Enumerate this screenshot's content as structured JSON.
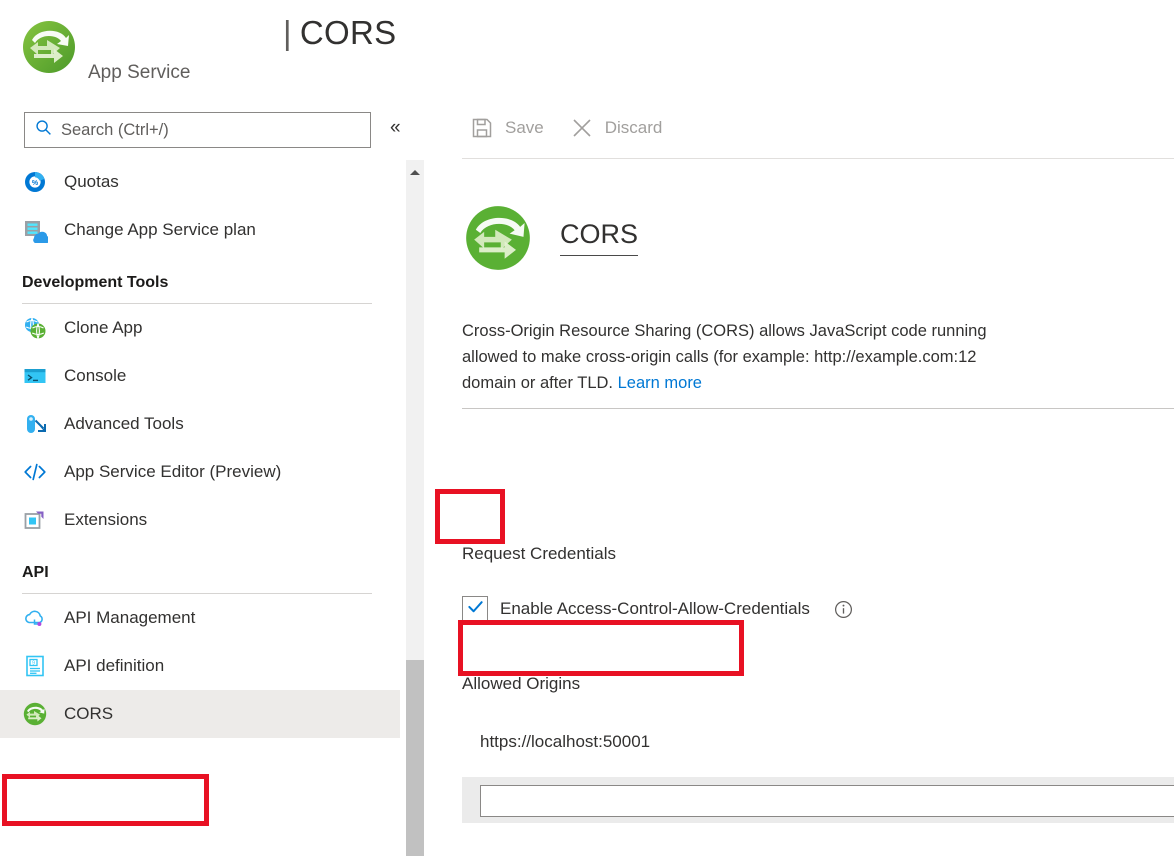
{
  "header": {
    "resource_name": "",
    "resource_type": "App Service",
    "blade_pipe": "|",
    "blade_title": "CORS",
    "logo_icon": "app-service-cors-icon"
  },
  "sidebar": {
    "search": {
      "placeholder": "Search (Ctrl+/)",
      "icon": "search-icon"
    },
    "collapse_icon": "chevron-double-left-icon",
    "items": [
      {
        "label": "Quotas",
        "icon": "quotas-percent-icon",
        "type": "item",
        "selected": false
      },
      {
        "label": "Change App Service plan",
        "icon": "app-service-plan-icon",
        "type": "item",
        "selected": false
      },
      {
        "label": "Development Tools",
        "type": "group"
      },
      {
        "label": "Clone App",
        "icon": "clone-app-icon",
        "type": "item",
        "selected": false
      },
      {
        "label": "Console",
        "icon": "console-terminal-icon",
        "type": "item",
        "selected": false
      },
      {
        "label": "Advanced Tools",
        "icon": "advanced-tools-icon",
        "type": "item",
        "selected": false
      },
      {
        "label": "App Service Editor (Preview)",
        "icon": "code-brackets-icon",
        "type": "item",
        "selected": false
      },
      {
        "label": "Extensions",
        "icon": "extensions-icon",
        "type": "item",
        "selected": false
      },
      {
        "label": "API",
        "type": "group"
      },
      {
        "label": "API Management",
        "icon": "api-management-cloud-icon",
        "type": "item",
        "selected": false
      },
      {
        "label": "API definition",
        "icon": "api-definition-document-icon",
        "type": "item",
        "selected": false
      },
      {
        "label": "CORS",
        "icon": "cors-icon",
        "type": "item",
        "selected": true
      }
    ],
    "scrollbar": {
      "up_arrow_icon": "scroll-up-arrow-icon"
    }
  },
  "toolbar": {
    "save_label": "Save",
    "save_icon": "save-floppy-icon",
    "discard_label": "Discard",
    "discard_icon": "discard-x-icon"
  },
  "main": {
    "title": "CORS",
    "title_icon": "cors-icon",
    "description_line1": "Cross-Origin Resource Sharing (CORS) allows JavaScript code running",
    "description_line2": "allowed to make cross-origin calls (for example: http://example.com:12",
    "description_line3_prefix": "domain or after TLD. ",
    "description_link": "Learn more",
    "request_credentials_label": "Request Credentials",
    "enable_credentials_label": "Enable Access-Control-Allow-Credentials",
    "enable_credentials_checked": true,
    "enable_credentials_info_icon": "info-circle-icon",
    "checkbox_check_icon": "checkmark-icon",
    "allowed_origins_label": "Allowed Origins",
    "allowed_origins": [
      "https://localhost:50001"
    ],
    "new_origin_placeholder": "",
    "new_origin_value": ""
  },
  "colors": {
    "accent_blue": "#0078d4",
    "annotation_red": "#e81123",
    "cors_green": "#5ab034",
    "selected_row_gray": "#edebe9",
    "muted_text": "#605e5c"
  }
}
